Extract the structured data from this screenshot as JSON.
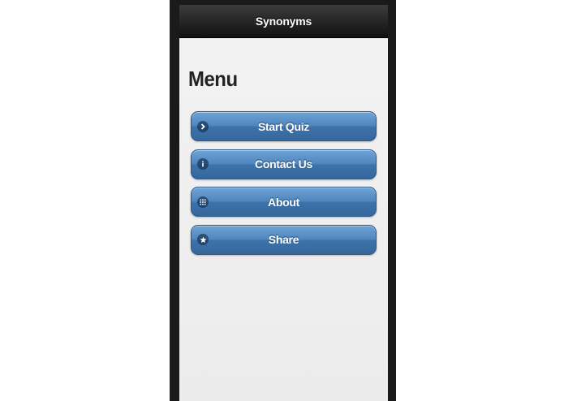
{
  "header": {
    "title": "Synonyms"
  },
  "page": {
    "title": "Menu"
  },
  "menu": {
    "items": [
      {
        "label": "Start Quiz",
        "icon": "chevron-right-icon"
      },
      {
        "label": "Contact Us",
        "icon": "info-icon"
      },
      {
        "label": "About",
        "icon": "grid-icon"
      },
      {
        "label": "Share",
        "icon": "star-icon"
      }
    ]
  },
  "colors": {
    "header_bg": "#1c1c1c",
    "button_blue": "#4f86be",
    "page_bg": "#f1f1f1"
  }
}
